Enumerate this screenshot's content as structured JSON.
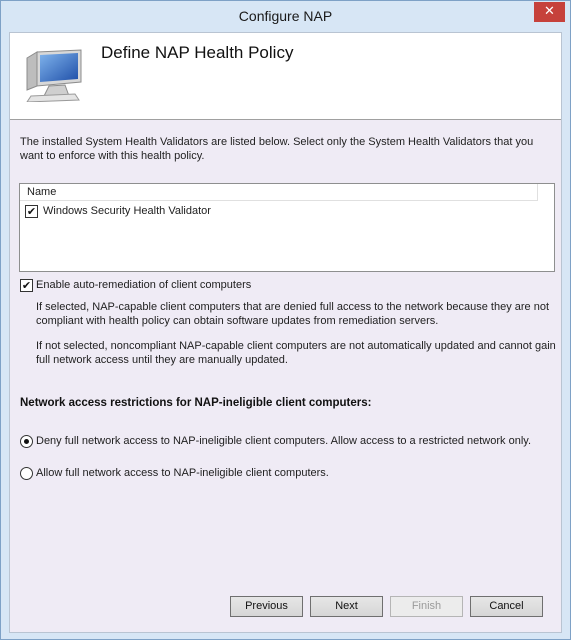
{
  "window": {
    "title": "Configure NAP",
    "close_glyph": "✕"
  },
  "header": {
    "title": "Define NAP Health Policy",
    "icon": "computer-monitor-icon"
  },
  "intro_text": "The installed System Health Validators are listed below. Select only the System Health Validators that you want to enforce with this health policy.",
  "validators": {
    "column_header": "Name",
    "items": [
      {
        "label": "Windows Security Health Validator",
        "checked": true
      }
    ]
  },
  "auto_remediation": {
    "label": "Enable auto-remediation of client computers",
    "checked": true,
    "desc_selected": "If selected, NAP-capable client computers that are denied full access to the network because they are not compliant with health policy can obtain software updates from remediation servers.",
    "desc_not_selected": "If not selected, noncompliant NAP-capable client computers are not automatically updated and cannot gain full network access until they are manually updated."
  },
  "restrictions": {
    "heading": "Network access restrictions for NAP-ineligible client computers:",
    "options": [
      {
        "label": "Deny full network access to NAP-ineligible client computers. Allow access to a restricted network only.",
        "selected": true
      },
      {
        "label": "Allow full network access to NAP-ineligible client computers.",
        "selected": false
      }
    ]
  },
  "buttons": {
    "previous": "Previous",
    "next": "Next",
    "finish": "Finish",
    "cancel": "Cancel"
  },
  "check_glyph": "✔"
}
